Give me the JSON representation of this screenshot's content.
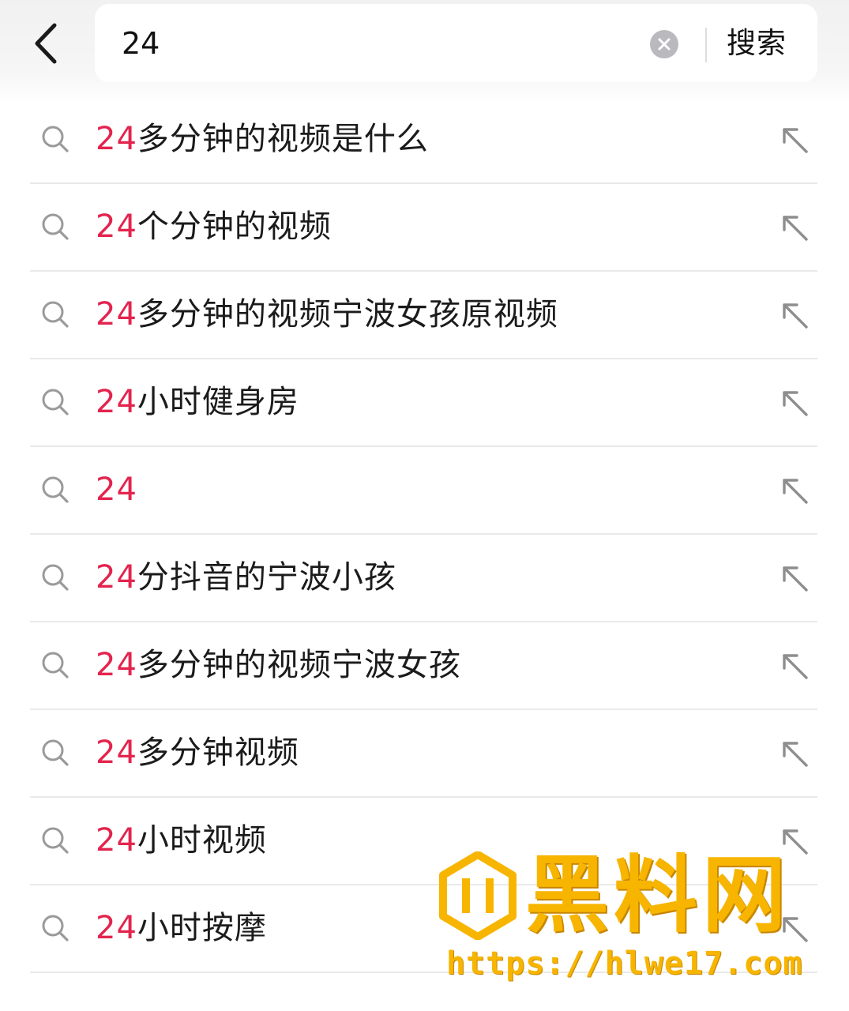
{
  "header": {
    "back_icon": "chevron-left-icon",
    "search": {
      "value": "24",
      "clear_icon": "clear-circle-icon",
      "submit_label": "搜索"
    }
  },
  "suggestions": [
    {
      "highlight": "24",
      "rest": "多分钟的视频是什么"
    },
    {
      "highlight": "24",
      "rest": "个分钟的视频"
    },
    {
      "highlight": "24",
      "rest": "多分钟的视频宁波女孩原视频"
    },
    {
      "highlight": "24",
      "rest": "小时健身房"
    },
    {
      "highlight": "24",
      "rest": ""
    },
    {
      "highlight": "24",
      "rest": "分抖音的宁波小孩"
    },
    {
      "highlight": "24",
      "rest": "多分钟的视频宁波女孩"
    },
    {
      "highlight": "24",
      "rest": "多分钟视频"
    },
    {
      "highlight": "24",
      "rest": "小时视频"
    },
    {
      "highlight": "24",
      "rest": "小时按摩"
    }
  ],
  "row_icons": {
    "leading": "search-icon",
    "trailing": "arrow-up-left-icon"
  },
  "colors": {
    "highlight": "#e3244e",
    "text": "#1b1b1b",
    "watermark": "#f7b500"
  },
  "watermark": {
    "title": "黑料网",
    "url": "https://hlwe17.com"
  }
}
